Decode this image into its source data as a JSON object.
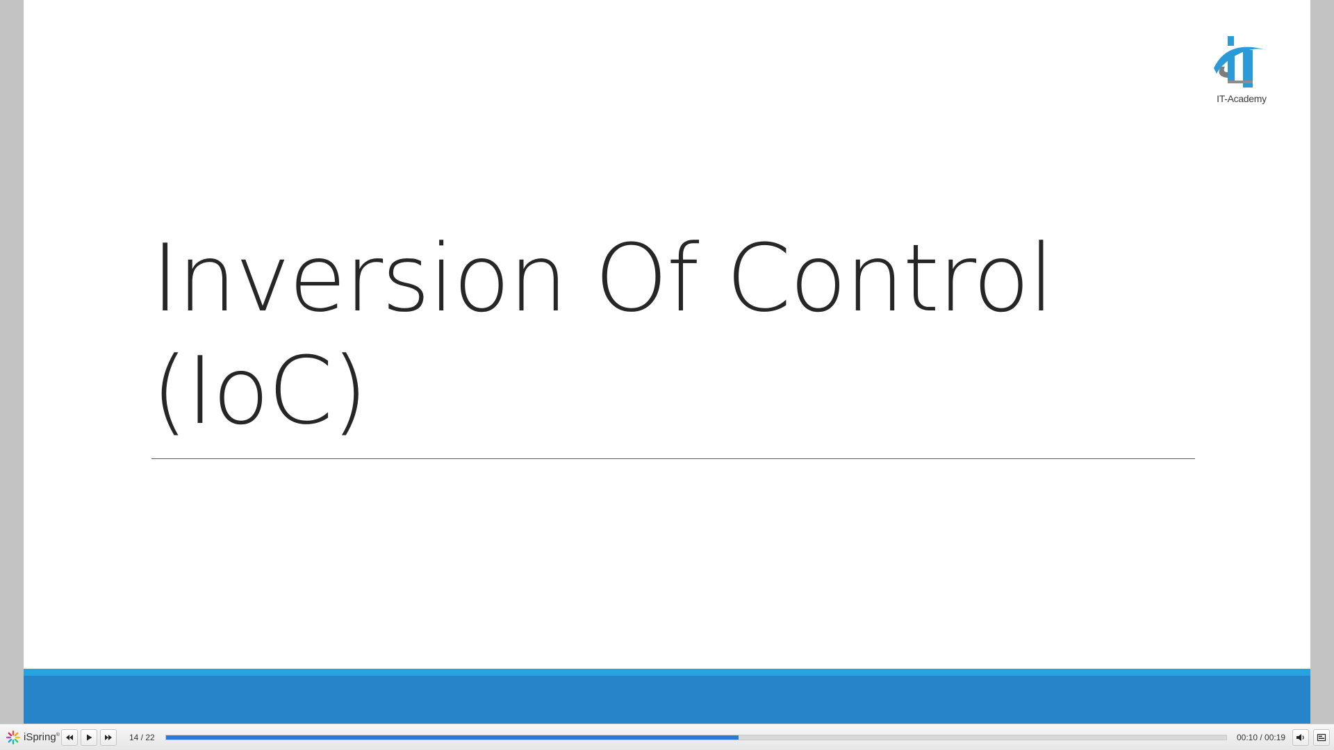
{
  "slide": {
    "title": "Inversion Of Control\n(IoC)",
    "logo": {
      "icon": "it-academy-logo",
      "text": "IT-Academy"
    },
    "colors": {
      "footer_stripe": "#29a3df",
      "footer_band": "#2884c8"
    }
  },
  "player": {
    "brand": "iSpring",
    "brand_mark": "®",
    "slide_counter": "14 / 22",
    "time": "00:10 / 00:19",
    "progress": 0.54,
    "buttons": {
      "previous": "rewind-icon",
      "play": "play-icon",
      "next": "fast-forward-icon",
      "volume": "volume-icon",
      "outline": "outline-icon"
    },
    "colors": {
      "progress_fill": "#2a79d9"
    }
  }
}
